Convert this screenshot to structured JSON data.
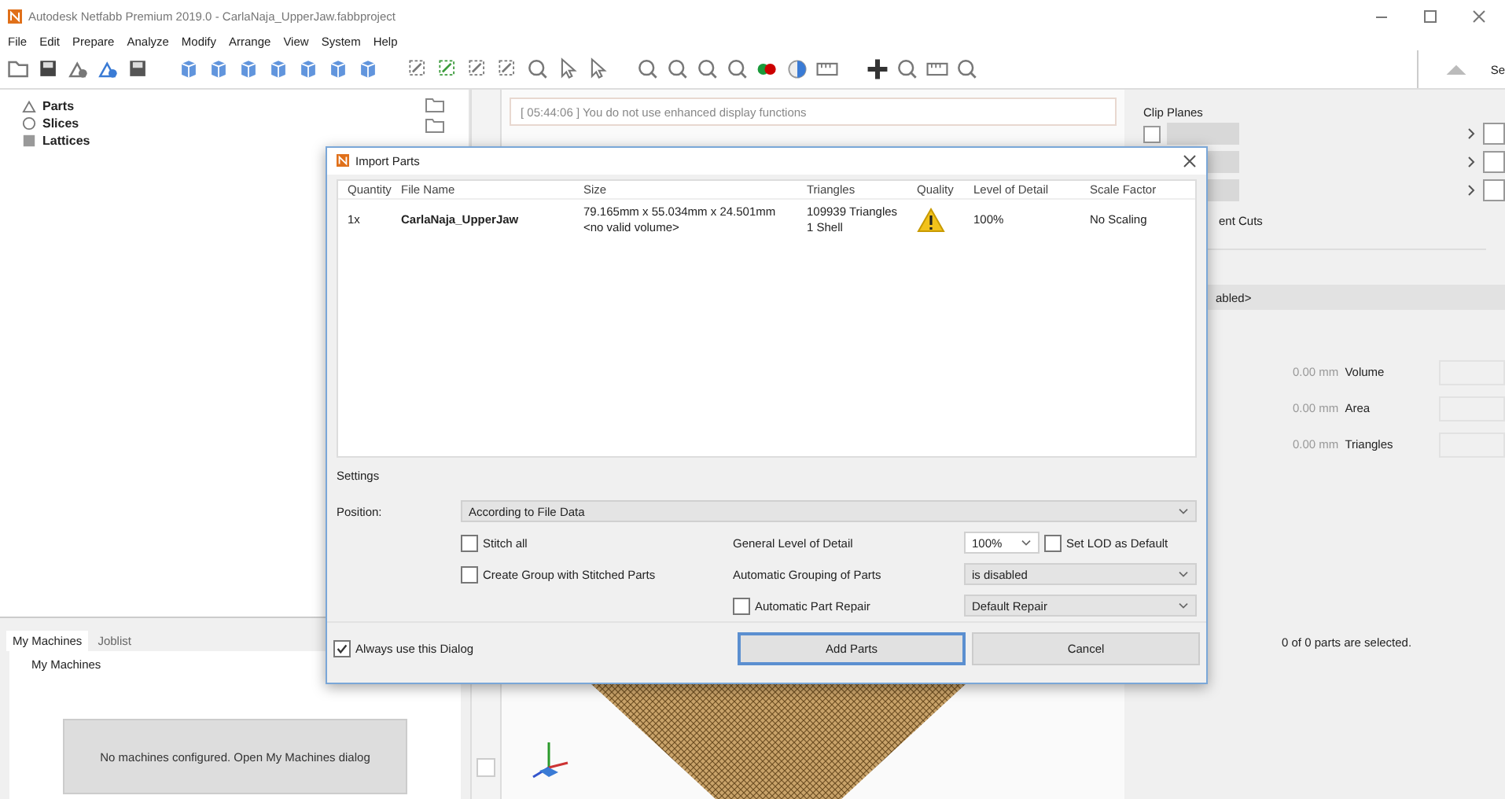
{
  "window": {
    "title": "Autodesk Netfabb Premium 2019.0 - CarlaNaja_UpperJaw.fabbproject"
  },
  "menu": [
    "File",
    "Edit",
    "Prepare",
    "Analyze",
    "Modify",
    "Arrange",
    "View",
    "System",
    "Help"
  ],
  "toolbar": {
    "tab_partial": "Se"
  },
  "tree": [
    {
      "label": "Parts",
      "kind": "parts"
    },
    {
      "label": "Slices",
      "kind": "slices"
    },
    {
      "label": "Lattices",
      "kind": "lattices"
    }
  ],
  "log": {
    "text": "[ 05:44:06 ] You do not use enhanced display functions"
  },
  "bottom_panel": {
    "tabs": [
      {
        "label": "My Machines",
        "selected": true
      },
      {
        "label": "Joblist",
        "selected": false
      }
    ],
    "group": "My Machines",
    "button": "No machines configured. Open My Machines dialog"
  },
  "right_panel": {
    "clip_planes": "Clip Planes",
    "clip_box": {
      "checked": false
    },
    "cuts_label": "ent Cuts",
    "combo": "abled>",
    "stats": [
      {
        "value": "0.00 mm",
        "label": "Volume"
      },
      {
        "value": "0.00 mm",
        "label": "Area"
      },
      {
        "value": "0.00 mm",
        "label": "Triangles"
      }
    ],
    "selection": "0 of 0 parts are selected."
  },
  "dialog": {
    "title": "Import Parts",
    "columns": [
      "Quantity",
      "File Name",
      "Size",
      "Triangles",
      "Quality",
      "Level of Detail",
      "Scale Factor"
    ],
    "rows": [
      {
        "quantity": "1x",
        "file_name": "CarlaNaja_UpperJaw",
        "size": [
          "79.165mm x 55.034mm x 24.501mm",
          "<no valid volume>"
        ],
        "triangles": [
          "109939 Triangles",
          "1 Shell"
        ],
        "quality_warning": true,
        "level_of_detail": "100%",
        "scale_factor": "No Scaling"
      }
    ],
    "settings": {
      "title": "Settings",
      "position_label": "Position:",
      "position": "According to File Data",
      "stitch_all": {
        "label": "Stitch all",
        "checked": false
      },
      "create_group": {
        "label": "Create Group with Stitched Parts",
        "checked": false
      },
      "lod_label": "General Level of Detail",
      "lod": "100%",
      "set_lod_default": {
        "label": "Set LOD as Default",
        "checked": false
      },
      "grouping_label": "Automatic Grouping of Parts",
      "grouping": "is disabled",
      "auto_repair": {
        "label": "Automatic Part Repair",
        "checked": false
      },
      "repair": "Default Repair"
    },
    "always_use": {
      "label": "Always use this Dialog",
      "checked": true
    },
    "buttons": [
      {
        "label": "Add Parts",
        "kind": "default"
      },
      {
        "label": "Cancel",
        "kind": "normal"
      }
    ]
  }
}
